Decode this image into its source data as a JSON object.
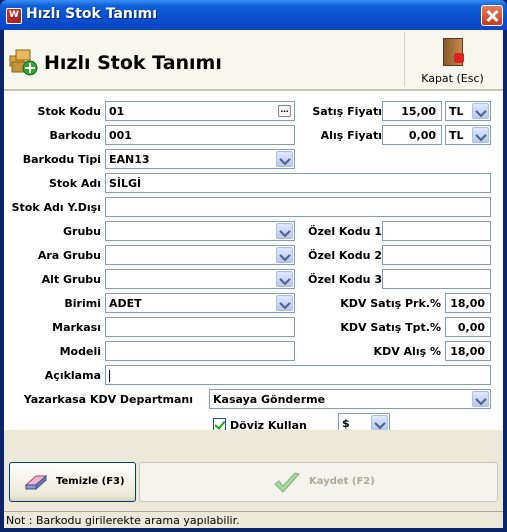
{
  "window": {
    "title": "Hızlı Stok Tanımı"
  },
  "header": {
    "title": "Hızlı Stok Tanımı",
    "close_label": "Kapat (Esc)"
  },
  "form": {
    "stok_kodu": {
      "label": "Stok Kodu",
      "value": "01"
    },
    "barkodu": {
      "label": "Barkodu",
      "value": "001"
    },
    "barkodu_tipi": {
      "label": "Barkodu Tipi",
      "value": "EAN13"
    },
    "stok_adi": {
      "label": "Stok Adı",
      "value": "SİLGİ"
    },
    "stok_adi_ydisi": {
      "label": "Stok Adı Y.Dışı",
      "value": ""
    },
    "grubu": {
      "label": "Grubu",
      "value": ""
    },
    "ara_grubu": {
      "label": "Ara Grubu",
      "value": ""
    },
    "alt_grubu": {
      "label": "Alt Grubu",
      "value": ""
    },
    "birimi": {
      "label": "Birimi",
      "value": "ADET"
    },
    "markasi": {
      "label": "Markası",
      "value": ""
    },
    "modeli": {
      "label": "Modeli",
      "value": ""
    },
    "aciklama": {
      "label": "Açıklama",
      "value": ""
    },
    "satis_fiyati": {
      "label": "Satış Fiyatı",
      "value": "15,00",
      "currency": "TL"
    },
    "alis_fiyati": {
      "label": "Alış Fiyatı",
      "value": "0,00",
      "currency": "TL"
    },
    "ozel_kodu_1": {
      "label": "Özel Kodu 1",
      "value": ""
    },
    "ozel_kodu_2": {
      "label": "Özel Kodu 2",
      "value": ""
    },
    "ozel_kodu_3": {
      "label": "Özel Kodu 3",
      "value": ""
    },
    "kdv_satis_prk": {
      "label": "KDV Satış Prk.%",
      "value": "18,00"
    },
    "kdv_satis_tpt": {
      "label": "KDV Satış Tpt.%",
      "value": "0,00"
    },
    "kdv_alis": {
      "label": "KDV Alış %",
      "value": "18,00"
    },
    "yazarkasa": {
      "label": "Yazarkasa KDV Departmanı",
      "value": "Kasaya Gönderme"
    },
    "doviz": {
      "label": "Döviz Kullan",
      "checked": true,
      "currency": "$"
    }
  },
  "buttons": {
    "clear_label": "Temizle (F3)",
    "save_label": "Kaydet (F2)"
  },
  "status": {
    "text": "Not : Barkodu girilerekte arama yapılabilir."
  }
}
